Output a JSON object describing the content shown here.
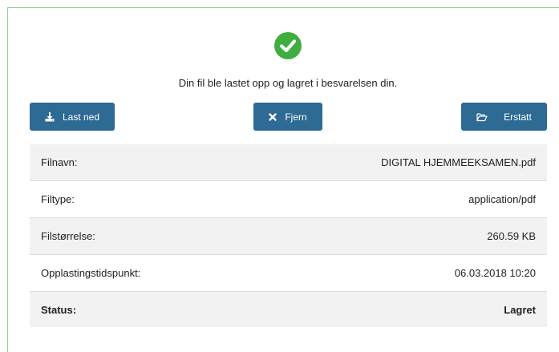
{
  "upload": {
    "message": "Din fil ble lastet opp og lagret i besvarelsen din."
  },
  "buttons": {
    "download": "Last ned",
    "remove": "Fjern",
    "replace": "Erstatt"
  },
  "details": [
    {
      "label": "Filnavn:",
      "value": "DIGITAL HJEMMEEKSAMEN.pdf"
    },
    {
      "label": "Filtype:",
      "value": "application/pdf"
    },
    {
      "label": "Filstørrelse:",
      "value": "260.59 KB"
    },
    {
      "label": "Opplastingstidspunkt:",
      "value": "06.03.2018 10:20"
    },
    {
      "label": "Status:",
      "value": "Lagret"
    }
  ],
  "colors": {
    "accent": "#2d6a94",
    "success": "#3fae3f",
    "row_shade": "#f2f2f2"
  },
  "icons": [
    "check-circle-icon",
    "download-icon",
    "close-icon",
    "folder-open-icon"
  ]
}
